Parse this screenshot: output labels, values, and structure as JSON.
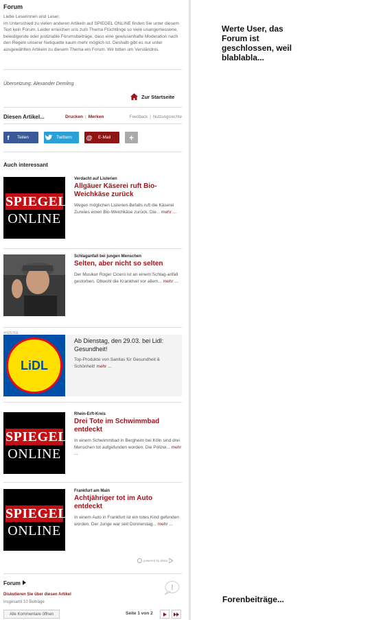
{
  "forum": {
    "title": "Forum",
    "text": "Liebe Leserinnen und Leser,\nim Unterschied zu vielen anderen Artikeln auf SPIEGEL ONLINE finden Sie unter diesem Text kein Forum. Leider erreichen uns zum Thema Flüchtlinge so viele unangemessene, beleidigende oder justiziable Forumsbeiträge, dass eine gewissenhafte Moderation nach den Regeln unserer Netiquette kaum mehr möglich ist. Deshalb gibt es nur unter ausgewählten Artikeln zu diesem Thema ein Forum. Wir bitten um Verständnis.",
    "translation": "Übersetzung: Alexander Demling",
    "home_link": "Zur Startseite"
  },
  "article_bar": {
    "label": "Diesen Artikel...",
    "print": "Drucken",
    "save": "Merken",
    "feedback": "Feedback",
    "rights": "Nutzungsrechte"
  },
  "share": {
    "facebook": "Teilen",
    "twitter": "Twittern",
    "email": "E-Mail",
    "more": "+"
  },
  "also_interesting": "Auch interessant",
  "logo": {
    "line1": "SPIEGEL",
    "line2": "ONLINE"
  },
  "items": [
    {
      "kicker": "Verdacht auf Listerien",
      "headline": "Allgäuer Käserei ruft Bio-Weichkäse zurück",
      "teaser": "Wegen möglichen Listerien-Befalls ruft die Käserei Zurwies einen Bio-Weichkäse zurück. Die...",
      "more": "mehr ..."
    },
    {
      "kicker": "Schlaganfall bei jungen Menschen",
      "headline": "Selten, aber nicht so selten",
      "teaser": "Der Musiker Roger Cicero ist an einem Schlag-anfall gestorben. Obwohl die Krankheit vor allem...",
      "more": "mehr ..."
    },
    {
      "kicker": "Rhein-Erft-Kreis",
      "headline": "Drei Tote im Schwimmbad entdeckt",
      "teaser": "In einem Schwimmbad in Bergheim bei Köln sind drei Menschen tot aufgefunden worden. Die Polizei...",
      "more": "mehr ..."
    },
    {
      "kicker": "Frankfurt am Main",
      "headline": "Achtjähriger tot im Auto entdeckt",
      "teaser": "In einem Auto in Frankfurt ist ein totes Kind gefunden worden. Der Junge war seit Donnerstag...",
      "more": "mehr ..."
    }
  ],
  "ad": {
    "label": "ANZEIGE",
    "title": "Ab Dienstag, den 29.03. bei Lidl: Gesundheit!",
    "teaser": "Top-Produkte von Sanitas für Gesundheit & Schönheit!",
    "more": "mehr ...",
    "logo": "LiDL"
  },
  "powered_by": "powered by plista",
  "forum_footer": {
    "title": "Forum",
    "discuss": "Diskutieren Sie über diesen Artikel",
    "count": "insgesamt 10 Beiträge",
    "open_all": "Alle Kommentare öffnen",
    "page": "Seite 1 von 2"
  },
  "notes": {
    "top": "Werte User, das Forum ist geschlossen, weil blablabla...",
    "bottom": "Forenbeiträge..."
  },
  "colors": {
    "accent": "#8c1a1a",
    "headline": "#a0141b",
    "spiegel_red": "#c30e14",
    "facebook": "#3b5998",
    "twitter": "#2a9fd8"
  }
}
